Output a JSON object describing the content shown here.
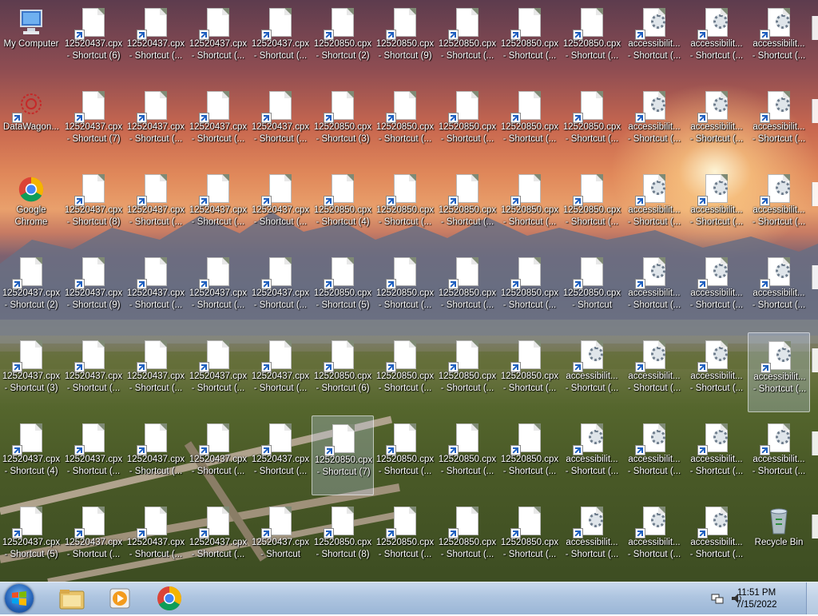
{
  "columns": [
    [
      {
        "label": "My Computer",
        "icon": "computer-icon"
      },
      {
        "label": "DataWagon...",
        "icon": "datawagon-icon",
        "shortcut": true
      },
      {
        "label": "Google\nChrome",
        "icon": "chrome-icon"
      },
      {
        "label": "12520437.cpx\n- Shortcut (2)",
        "icon": "document-icon",
        "shortcut": true
      },
      {
        "label": "12520437.cpx\n- Shortcut (3)",
        "icon": "document-icon",
        "shortcut": true
      },
      {
        "label": "12520437.cpx\n- Shortcut (4)",
        "icon": "document-icon",
        "shortcut": true
      },
      {
        "label": "12520437.cpx\n- Shortcut (5)",
        "icon": "document-icon",
        "shortcut": true
      }
    ],
    [
      {
        "label": "12520437.cpx\n- Shortcut (6)",
        "icon": "document-icon",
        "shortcut": true
      },
      {
        "label": "12520437.cpx\n- Shortcut (7)",
        "icon": "document-icon",
        "shortcut": true
      },
      {
        "label": "12520437.cpx\n- Shortcut (8)",
        "icon": "document-icon",
        "shortcut": true
      },
      {
        "label": "12520437.cpx\n- Shortcut (9)",
        "icon": "document-icon",
        "shortcut": true
      },
      {
        "label": "12520437.cpx\n- Shortcut (...",
        "icon": "document-icon",
        "shortcut": true
      },
      {
        "label": "12520437.cpx\n- Shortcut (...",
        "icon": "document-icon",
        "shortcut": true
      },
      {
        "label": "12520437.cpx\n- Shortcut (...",
        "icon": "document-icon",
        "shortcut": true
      }
    ],
    [
      {
        "label": "12520437.cpx\n- Shortcut (...",
        "icon": "document-icon",
        "shortcut": true
      },
      {
        "label": "12520437.cpx\n- Shortcut (...",
        "icon": "document-icon",
        "shortcut": true
      },
      {
        "label": "12520437.cpx\n- Shortcut (...",
        "icon": "document-icon",
        "shortcut": true
      },
      {
        "label": "12520437.cpx\n- Shortcut (...",
        "icon": "document-icon",
        "shortcut": true
      },
      {
        "label": "12520437.cpx\n- Shortcut (...",
        "icon": "document-icon",
        "shortcut": true
      },
      {
        "label": "12520437.cpx\n- Shortcut (...",
        "icon": "document-icon",
        "shortcut": true
      },
      {
        "label": "12520437.cpx\n- Shortcut (...",
        "icon": "document-icon",
        "shortcut": true
      }
    ],
    [
      {
        "label": "12520437.cpx\n- Shortcut (...",
        "icon": "document-icon",
        "shortcut": true
      },
      {
        "label": "12520437.cpx\n- Shortcut (...",
        "icon": "document-icon",
        "shortcut": true
      },
      {
        "label": "12520437.cpx\n- Shortcut (...",
        "icon": "document-icon",
        "shortcut": true
      },
      {
        "label": "12520437.cpx\n- Shortcut (...",
        "icon": "document-icon",
        "shortcut": true
      },
      {
        "label": "12520437.cpx\n- Shortcut (...",
        "icon": "document-icon",
        "shortcut": true
      },
      {
        "label": "12520437.cpx\n- Shortcut (...",
        "icon": "document-icon",
        "shortcut": true
      },
      {
        "label": "12520437.cpx\n- Shortcut (...",
        "icon": "document-icon",
        "shortcut": true
      }
    ],
    [
      {
        "label": "12520437.cpx\n- Shortcut (...",
        "icon": "document-icon",
        "shortcut": true
      },
      {
        "label": "12520437.cpx\n- Shortcut (...",
        "icon": "document-icon",
        "shortcut": true
      },
      {
        "label": "12520437.cpx\n- Shortcut (...",
        "icon": "document-icon",
        "shortcut": true
      },
      {
        "label": "12520437.cpx\n- Shortcut (...",
        "icon": "document-icon",
        "shortcut": true
      },
      {
        "label": "12520437.cpx\n- Shortcut (...",
        "icon": "document-icon",
        "shortcut": true
      },
      {
        "label": "12520437.cpx\n- Shortcut (...",
        "icon": "document-icon",
        "shortcut": true
      },
      {
        "label": "12520437.cpx\n- Shortcut",
        "icon": "document-icon",
        "shortcut": true
      }
    ],
    [
      {
        "label": "12520850.cpx\n- Shortcut (2)",
        "icon": "document-icon",
        "shortcut": true
      },
      {
        "label": "12520850.cpx\n- Shortcut (3)",
        "icon": "document-icon",
        "shortcut": true
      },
      {
        "label": "12520850.cpx\n- Shortcut (4)",
        "icon": "document-icon",
        "shortcut": true
      },
      {
        "label": "12520850.cpx\n- Shortcut (5)",
        "icon": "document-icon",
        "shortcut": true
      },
      {
        "label": "12520850.cpx\n- Shortcut (6)",
        "icon": "document-icon",
        "shortcut": true
      },
      {
        "label": "12520850.cpx\n- Shortcut (7)",
        "icon": "document-icon",
        "shortcut": true,
        "selected": true
      },
      {
        "label": "12520850.cpx\n- Shortcut (8)",
        "icon": "document-icon",
        "shortcut": true
      }
    ],
    [
      {
        "label": "12520850.cpx\n- Shortcut (9)",
        "icon": "document-icon",
        "shortcut": true
      },
      {
        "label": "12520850.cpx\n- Shortcut (...",
        "icon": "document-icon",
        "shortcut": true
      },
      {
        "label": "12520850.cpx\n- Shortcut (...",
        "icon": "document-icon",
        "shortcut": true
      },
      {
        "label": "12520850.cpx\n- Shortcut (...",
        "icon": "document-icon",
        "shortcut": true
      },
      {
        "label": "12520850.cpx\n- Shortcut (...",
        "icon": "document-icon",
        "shortcut": true
      },
      {
        "label": "12520850.cpx\n- Shortcut (...",
        "icon": "document-icon",
        "shortcut": true
      },
      {
        "label": "12520850.cpx\n- Shortcut (...",
        "icon": "document-icon",
        "shortcut": true
      }
    ],
    [
      {
        "label": "12520850.cpx\n- Shortcut (...",
        "icon": "document-icon",
        "shortcut": true
      },
      {
        "label": "12520850.cpx\n- Shortcut (...",
        "icon": "document-icon",
        "shortcut": true
      },
      {
        "label": "12520850.cpx\n- Shortcut (...",
        "icon": "document-icon",
        "shortcut": true
      },
      {
        "label": "12520850.cpx\n- Shortcut (...",
        "icon": "document-icon",
        "shortcut": true
      },
      {
        "label": "12520850.cpx\n- Shortcut (...",
        "icon": "document-icon",
        "shortcut": true
      },
      {
        "label": "12520850.cpx\n- Shortcut (...",
        "icon": "document-icon",
        "shortcut": true
      },
      {
        "label": "12520850.cpx\n- Shortcut (...",
        "icon": "document-icon",
        "shortcut": true
      }
    ],
    [
      {
        "label": "12520850.cpx\n- Shortcut (...",
        "icon": "document-icon",
        "shortcut": true
      },
      {
        "label": "12520850.cpx\n- Shortcut (...",
        "icon": "document-icon",
        "shortcut": true
      },
      {
        "label": "12520850.cpx\n- Shortcut (...",
        "icon": "document-icon",
        "shortcut": true
      },
      {
        "label": "12520850.cpx\n- Shortcut (...",
        "icon": "document-icon",
        "shortcut": true
      },
      {
        "label": "12520850.cpx\n- Shortcut (...",
        "icon": "document-icon",
        "shortcut": true
      },
      {
        "label": "12520850.cpx\n- Shortcut (...",
        "icon": "document-icon",
        "shortcut": true
      },
      {
        "label": "12520850.cpx\n- Shortcut (...",
        "icon": "document-icon",
        "shortcut": true
      }
    ],
    [
      {
        "label": "12520850.cpx\n- Shortcut (...",
        "icon": "document-icon",
        "shortcut": true
      },
      {
        "label": "12520850.cpx\n- Shortcut (...",
        "icon": "document-icon",
        "shortcut": true
      },
      {
        "label": "12520850.cpx\n- Shortcut (...",
        "icon": "document-icon",
        "shortcut": true
      },
      {
        "label": "12520850.cpx\n- Shortcut",
        "icon": "document-icon",
        "shortcut": true
      },
      {
        "label": "accessibilit...\n- Shortcut (...",
        "icon": "settings-document-icon",
        "shortcut": true
      },
      {
        "label": "accessibilit...\n- Shortcut (...",
        "icon": "settings-document-icon",
        "shortcut": true
      },
      {
        "label": "accessibilit...\n- Shortcut (...",
        "icon": "settings-document-icon",
        "shortcut": true
      }
    ],
    [
      {
        "label": "accessibilit...\n- Shortcut (...",
        "icon": "settings-document-icon",
        "shortcut": true
      },
      {
        "label": "accessibilit...\n- Shortcut (...",
        "icon": "settings-document-icon",
        "shortcut": true
      },
      {
        "label": "accessibilit...\n- Shortcut (...",
        "icon": "settings-document-icon",
        "shortcut": true
      },
      {
        "label": "accessibilit...\n- Shortcut (...",
        "icon": "settings-document-icon",
        "shortcut": true
      },
      {
        "label": "accessibilit...\n- Shortcut (...",
        "icon": "settings-document-icon",
        "shortcut": true
      },
      {
        "label": "accessibilit...\n- Shortcut (...",
        "icon": "settings-document-icon",
        "shortcut": true
      },
      {
        "label": "accessibilit...\n- Shortcut (...",
        "icon": "settings-document-icon",
        "shortcut": true
      }
    ],
    [
      {
        "label": "accessibilit...\n- Shortcut (...",
        "icon": "settings-document-icon",
        "shortcut": true
      },
      {
        "label": "accessibilit...\n- Shortcut (...",
        "icon": "settings-document-icon",
        "shortcut": true
      },
      {
        "label": "accessibilit...\n- Shortcut (...",
        "icon": "settings-document-icon",
        "shortcut": true
      },
      {
        "label": "accessibilit...\n- Shortcut (...",
        "icon": "settings-document-icon",
        "shortcut": true
      },
      {
        "label": "accessibilit...\n- Shortcut (...",
        "icon": "settings-document-icon",
        "shortcut": true
      },
      {
        "label": "accessibilit...\n- Shortcut (...",
        "icon": "settings-document-icon",
        "shortcut": true
      },
      {
        "label": "accessibilit...\n- Shortcut (...",
        "icon": "settings-document-icon",
        "shortcut": true
      }
    ],
    [
      {
        "label": "accessibilit...\n- Shortcut (...",
        "icon": "settings-document-icon",
        "shortcut": true
      },
      {
        "label": "accessibilit...\n- Shortcut (...",
        "icon": "settings-document-icon",
        "shortcut": true
      },
      {
        "label": "accessibilit...\n- Shortcut (...",
        "icon": "settings-document-icon",
        "shortcut": true
      },
      {
        "label": "accessibilit...\n- Shortcut (...",
        "icon": "settings-document-icon",
        "shortcut": true
      },
      {
        "label": "accessibilit...\n- Shortcut (...",
        "icon": "settings-document-icon",
        "shortcut": true,
        "selected": true
      },
      {
        "label": "accessibilit...\n- Shortcut (...",
        "icon": "settings-document-icon",
        "shortcut": true
      },
      {
        "label": "Recycle Bin",
        "icon": "recycle-bin-icon"
      }
    ]
  ],
  "taskbar": {
    "start_icon": "windows-start-icon",
    "apps": [
      {
        "name": "file-explorer",
        "icon": "folder-icon"
      },
      {
        "name": "media-player",
        "icon": "media-player-icon"
      },
      {
        "name": "chrome",
        "icon": "chrome-icon"
      }
    ],
    "tray_icons": [
      "network-icon",
      "volume-icon"
    ],
    "clock": {
      "time": "11:51 PM",
      "date": "7/15/2022"
    }
  },
  "colors": {
    "taskbar": "#aec5e0",
    "selection": "#c8dcff",
    "shortcut_arrow": "#1e5fbf"
  }
}
